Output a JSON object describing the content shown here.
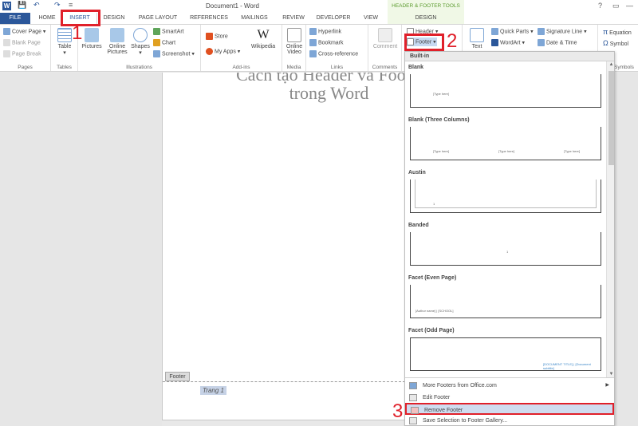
{
  "title_bar": {
    "app_icon": "W",
    "document_title": "Document1 - Word",
    "tools_title": "HEADER & FOOTER TOOLS",
    "help": "?"
  },
  "tabs": [
    "FILE",
    "HOME",
    "INSERT",
    "DESIGN",
    "PAGE LAYOUT",
    "REFERENCES",
    "MAILINGS",
    "REVIEW",
    "DEVELOPER",
    "VIEW",
    "DESIGN"
  ],
  "ribbon": {
    "pages": {
      "cover_page": "Cover Page",
      "blank_page": "Blank Page",
      "page_break": "Page Break",
      "label": "Pages"
    },
    "tables": {
      "table": "Table",
      "label": "Tables"
    },
    "illustrations": {
      "pictures": "Pictures",
      "online_pictures_1": "Online",
      "online_pictures_2": "Pictures",
      "shapes": "Shapes",
      "smartart": "SmartArt",
      "chart": "Chart",
      "screenshot": "Screenshot",
      "label": "Illustrations"
    },
    "addins": {
      "store": "Store",
      "my_apps": "My Apps",
      "wikipedia": "Wikipedia",
      "label": "Add-ins"
    },
    "media": {
      "online_video_1": "Online",
      "online_video_2": "Video",
      "label": "Media"
    },
    "links": {
      "hyperlink": "Hyperlink",
      "bookmark": "Bookmark",
      "cross_reference": "Cross-reference",
      "label": "Links"
    },
    "comments": {
      "comment": "Comment",
      "label": "Comments"
    },
    "header_footer": {
      "header": "Header",
      "footer": "Footer"
    },
    "text": {
      "text_box": "Text",
      "quick_parts": "Quick Parts",
      "wordart": "WordArt",
      "signature_line": "Signature Line",
      "date_time": "Date & Time"
    },
    "symbols": {
      "equation": "Equation",
      "symbol": "Symbol",
      "label": "Symbols"
    }
  },
  "document": {
    "heading_line1": "Cách tạo Header và Footer",
    "heading_line2": "trong Word",
    "footer_label": "Footer",
    "footer_text": "Trang 1"
  },
  "gallery": {
    "section_header": "Built-in",
    "items": [
      {
        "name": "Blank",
        "placeholders": [
          "[Type here]"
        ]
      },
      {
        "name": "Blank (Three Columns)",
        "placeholders": [
          "[Type here]",
          "[Type here]",
          "[Type here]"
        ]
      },
      {
        "name": "Austin",
        "placeholders": [
          "1"
        ]
      },
      {
        "name": "Banded",
        "placeholders": [
          "1"
        ]
      },
      {
        "name": "Facet (Even Page)",
        "placeholders": [
          "[Author name] | [SCHOOL]"
        ]
      },
      {
        "name": "Facet (Odd Page)",
        "placeholders": [
          "[DOCUMENT TITLE] | [Document subtitle]"
        ]
      }
    ],
    "menu": {
      "more_footers": "More Footers from Office.com",
      "edit_footer": "Edit Footer",
      "remove_footer": "Remove Footer",
      "save_selection": "Save Selection to Footer Gallery..."
    }
  },
  "annotations": {
    "step1": "1",
    "step2": "2",
    "step3": "3"
  },
  "colors": {
    "accent": "#2b579a",
    "annotation_red": "#e0202a",
    "tools_green": "#5b9b2e",
    "selected_item": "#cfdcef"
  }
}
